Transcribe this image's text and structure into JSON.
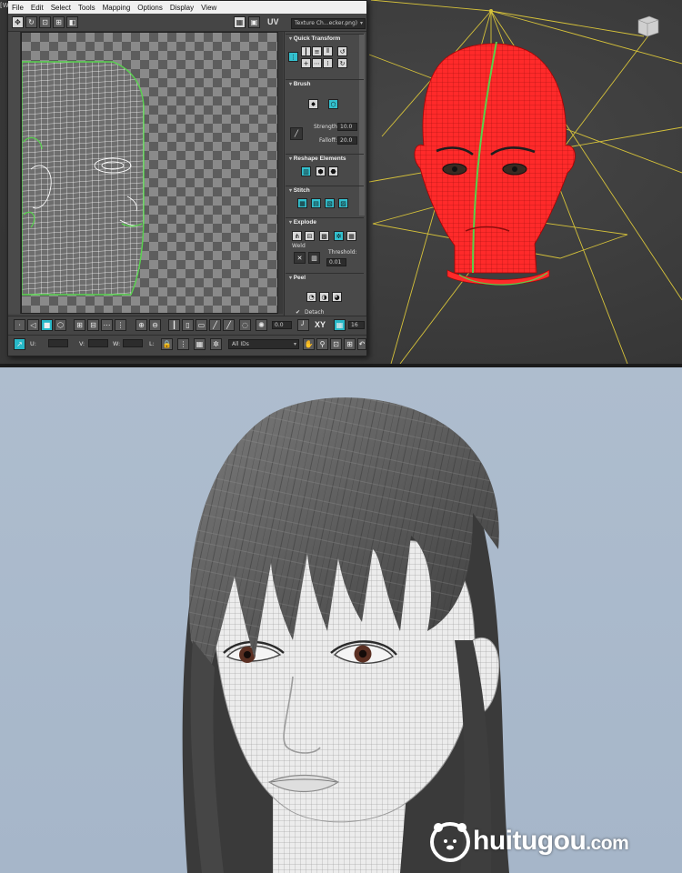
{
  "window_fragment": "[W",
  "menu": {
    "items": [
      "File",
      "Edit",
      "Select",
      "Tools",
      "Mapping",
      "Options",
      "Display",
      "View"
    ]
  },
  "toolbar": {
    "uv_label": "UV",
    "texture_dropdown": "Texture Ch...ecker.png)"
  },
  "rollouts": {
    "quick_transform": "Quick Transform",
    "brush": "Brush",
    "strength_label": "Strength:",
    "strength_value": "10.0",
    "falloff_label": "Falloff:",
    "falloff_value": "20.0",
    "reshape_elements": "Reshape Elements",
    "stitch": "Stitch",
    "explode": "Explode",
    "weld_label": "Weld",
    "threshold_label": "Threshold:",
    "threshold_value": "0.01",
    "peel": "Peel",
    "detach_label": "Detach",
    "detach_checked": true
  },
  "bottom_toolbar": {
    "spinner_value": "0.0",
    "xy_label": "XY",
    "grid_value": "16",
    "u_label": "U:",
    "v_label": "V:",
    "w_label": "W:",
    "l_label": "L:",
    "ids_dropdown": "All IDs"
  },
  "watermark": {
    "text_big": "huitugou",
    "text_small": ".com"
  },
  "colors": {
    "viewport_bg": "#3e3e3e",
    "head_selected": "#ff2a2a",
    "seam": "#5ad14a",
    "gizmo": "#d6c23a",
    "accent_cyan": "#28b8c8",
    "render_bg": "#a9b9cc"
  }
}
